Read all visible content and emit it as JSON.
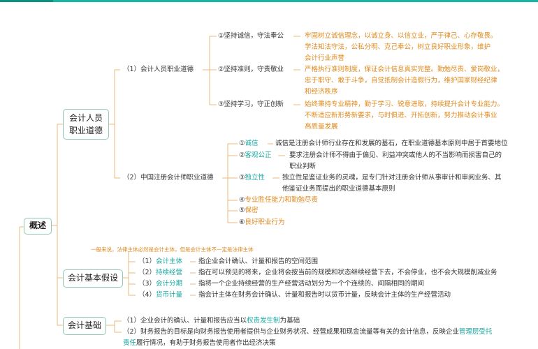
{
  "root": "概述",
  "branches": {
    "ethics": {
      "label_line1": "会计人员",
      "label_line2": "职业道德",
      "sub1": {
        "title": "（1）会计人员职业道德",
        "items": [
          {
            "key": "①坚持诚信，守法奉公",
            "desc": [
              "牢固树立诚信理念，以诚立身、以信立业，严于律己、心存敬畏。",
              "学法知法守法，公私分明、克己奉公，树立良好职业形象，维护",
              "会计行业声誉"
            ]
          },
          {
            "key": "②坚持准则，守责敬业",
            "desc": [
              "严格执行准则制度，保证会计信息真实完整。勤勉尽责、爱岗敬业，",
              "忠于职守、敢于斗争，自觉抵制会计造假行为，维护国家财经纪律",
              "和经济秩序"
            ]
          },
          {
            "key": "③坚持学习，守正创新",
            "desc": [
              "始终秉持专业精神，勤于学习、锐意进取，持续提升会计专业能力。",
              "不断适应新形势新要求，与时俱进、开拓创新，努力推动会计事业",
              "高质量发展"
            ]
          }
        ]
      },
      "sub2": {
        "title": "（2）中国注册会计师职业道德",
        "items": [
          {
            "num": "①",
            "key": "诚信",
            "desc": [
              "诚信是注册会计师行业存在和发展的基石，在职业道德基本原则中居于首要地位"
            ]
          },
          {
            "num": "②",
            "key": "客观公正",
            "desc": [
              "要求注册会计师不得由于偏见、利益冲突或他人的不当影响而损害自己的",
              "职业判断"
            ]
          },
          {
            "num": "③",
            "key": "独立性",
            "desc": [
              "独立性是鉴证业务的灵魂，是专门针对注册会计师从事审计和审阅业务、其",
              "他鉴证业务而提出的职业道德基本原则"
            ]
          },
          {
            "num": "④",
            "key": "专业胜任能力和勤勉尽责",
            "desc": []
          },
          {
            "num": "⑤",
            "key": "保密",
            "desc": []
          },
          {
            "num": "⑥",
            "key": "良好职业行为",
            "desc": []
          }
        ]
      }
    },
    "assumptions": {
      "note": "一般来说，法律主体必然是会计主体，但是会计主体不一定是法律主体",
      "label": "会计基本假设",
      "items": [
        {
          "num": "（1）",
          "key": "会计主体",
          "desc": "指企业会计确认、计量和报告的空间范围"
        },
        {
          "num": "（2）",
          "key": "持续经营",
          "desc": "指在可以预见的将来，企业将会按当前的规模和状态继续经营下去，不会停业，也不会大规模削减业务"
        },
        {
          "num": "（3）",
          "key": "会计分期",
          "desc": "指将一个企业持续经营的生产经营活动划分为一个个连续的、间隔相同的期间"
        },
        {
          "num": "（4）",
          "key": "货币计量",
          "desc": "指会计主体在财务会计确认、计量和报告时以货币计量，反映会计主体的生产经营活动"
        }
      ]
    },
    "basis": {
      "label": "会计基础",
      "line1_pre": "（1）企业会计的确认、计量和报告应当以",
      "line1_hl": "权责发生制",
      "line1_post": "为基础",
      "line2_pre": "（2）财务报告的目标是向财务报告使用者提供与企业财务状况、经营成果和现金流量等有关的会计信息，反映企业",
      "line2_hl": "管理层受托",
      "line3_hl": "责任",
      "line3_post": "履行情况，有助于财务报告使用者作出经济决策"
    }
  },
  "colors": {
    "accent": "#18a7a0",
    "highlight": "#e08a1e",
    "border": "#8ec9b0",
    "line": "#e8b878"
  }
}
